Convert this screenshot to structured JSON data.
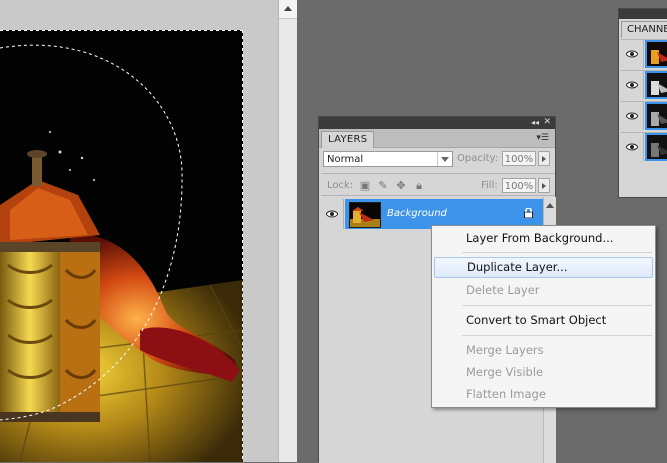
{
  "layers_panel": {
    "tab_label": "LAYERS",
    "blend_mode": "Normal",
    "opacity_label": "Opacity:",
    "opacity_value": "100%",
    "lock_label": "Lock:",
    "fill_label": "Fill:",
    "fill_value": "100%",
    "layers": [
      {
        "name": "Background",
        "selected": true,
        "locked": true
      }
    ]
  },
  "channels_panel": {
    "tab_label": "CHANNELS"
  },
  "context_menu": {
    "items": [
      {
        "label": "Layer From Background...",
        "enabled": true
      },
      {
        "label": "Duplicate Layer...",
        "enabled": true,
        "highlighted": true
      },
      {
        "label": "Delete Layer",
        "enabled": false
      },
      {
        "label": "Convert to Smart Object",
        "enabled": true
      },
      {
        "label": "Merge Layers",
        "enabled": false
      },
      {
        "label": "Merge Visible",
        "enabled": false
      },
      {
        "label": "Flatten Image",
        "enabled": false
      }
    ]
  },
  "colors": {
    "selection": "#3d93ea",
    "workspace": "#6b6b6b",
    "panel": "#d6d6d6",
    "panel_titlebar": "#3b3b3b"
  }
}
